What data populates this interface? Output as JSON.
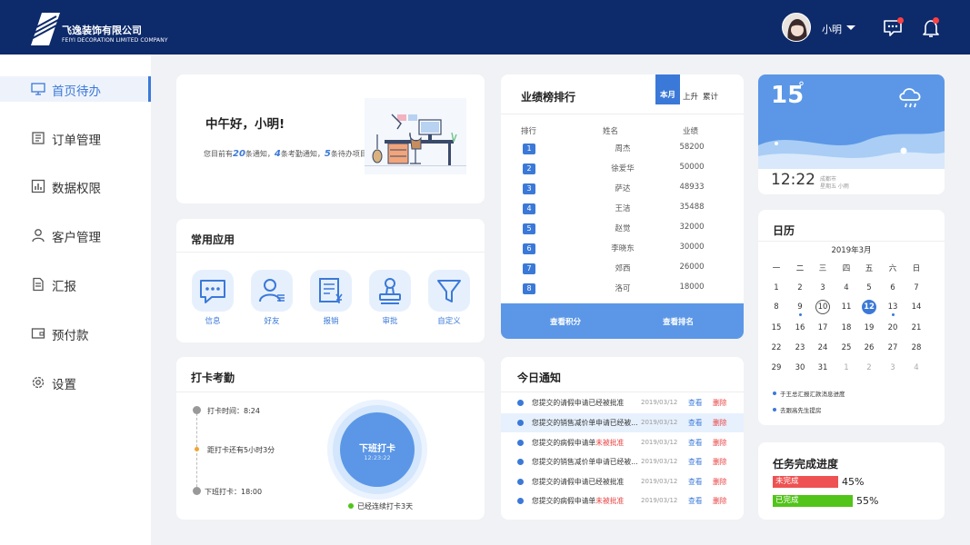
{
  "header": {
    "company_name": "飞逸装饰有限公司",
    "company_name_en": "FEIYI DECORATION LIMITED COMPANY",
    "user_name": "小明",
    "brand_color": "#0d2a6b"
  },
  "sidebar": {
    "items": [
      {
        "label": "首页待办",
        "icon": "monitor-icon",
        "active": true
      },
      {
        "label": "订单管理",
        "icon": "order-icon"
      },
      {
        "label": "数据权限",
        "icon": "chart-icon"
      },
      {
        "label": "客户管理",
        "icon": "user-icon"
      },
      {
        "label": "汇报",
        "icon": "report-icon"
      },
      {
        "label": "预付款",
        "icon": "wallet-icon"
      },
      {
        "label": "设置",
        "icon": "gear-icon"
      }
    ]
  },
  "welcome": {
    "greeting": "中午好，小明!",
    "sub_pre": "您目前有",
    "n1": "20",
    "sub_1": "条通知，",
    "n2": "4",
    "sub_2": "条考勤通知，",
    "n3": "5",
    "sub_3": "条待办项目"
  },
  "apps": {
    "title": "常用应用",
    "items": [
      {
        "label": "信息",
        "icon": "chat-icon"
      },
      {
        "label": "好友",
        "icon": "friend-icon"
      },
      {
        "label": "报销",
        "icon": "reimburse-icon"
      },
      {
        "label": "审批",
        "icon": "stamp-icon"
      },
      {
        "label": "自定义",
        "icon": "filter-icon"
      }
    ]
  },
  "attendance": {
    "title": "打卡考勤",
    "clock_in": "打卡时间：8:24",
    "remaining": "距打卡还有5小时3分",
    "clock_out": "下班打卡：18:00",
    "button_label": "下班打卡",
    "button_time": "12:23:22",
    "streak": "已经连续打卡3天"
  },
  "ranking": {
    "title": "业绩榜排行",
    "tabs": [
      "本月",
      "上升",
      "累计"
    ],
    "columns": [
      "排行",
      "姓名",
      "业绩"
    ],
    "rows": [
      {
        "rank": "1",
        "name": "周杰",
        "value": "58200"
      },
      {
        "rank": "2",
        "name": "徐爱华",
        "value": "50000"
      },
      {
        "rank": "3",
        "name": "萨达",
        "value": "48933"
      },
      {
        "rank": "4",
        "name": "王洁",
        "value": "35488"
      },
      {
        "rank": "5",
        "name": "赵觉",
        "value": "32000"
      },
      {
        "rank": "6",
        "name": "李晓东",
        "value": "30000"
      },
      {
        "rank": "7",
        "name": "郊西",
        "value": "26000"
      },
      {
        "rank": "8",
        "name": "洛可",
        "value": "18000"
      }
    ],
    "footer_left": "查看积分",
    "footer_right": "查看排名"
  },
  "notices": {
    "title": "今日通知",
    "view_label": "查看",
    "delete_label": "删除",
    "items": [
      {
        "text": "您提交的请假申请已经被批准",
        "red": "",
        "date": "2019/03/12"
      },
      {
        "text": "您提交的销售减价单申请已经被...",
        "red": "",
        "date": "2019/03/12"
      },
      {
        "text": "您提交的病假申请单",
        "red": "未被批准",
        "date": "2019/03/12"
      },
      {
        "text": "您提交的销售减价单申请已经被...",
        "red": "",
        "date": "2019/03/12"
      },
      {
        "text": "您提交的请假申请已经被批准",
        "red": "",
        "date": "2019/03/12"
      },
      {
        "text": "您提交的病假申请单",
        "red": "未被批准",
        "date": "2019/03/12"
      }
    ]
  },
  "weather": {
    "temperature": "15",
    "degree": "°",
    "time": "12:22",
    "location": "成都市",
    "detail": "星期五 小雨"
  },
  "calendar": {
    "title": "日历",
    "month": "2019年3月",
    "weekdays": [
      "一",
      "二",
      "三",
      "四",
      "五",
      "六",
      "日"
    ],
    "days": [
      [
        "1",
        "2",
        "3",
        "4",
        "5",
        "6",
        "7"
      ],
      [
        "8",
        "9",
        "10",
        "11",
        "12",
        "13",
        "14"
      ],
      [
        "15",
        "16",
        "17",
        "18",
        "19",
        "20",
        "21"
      ],
      [
        "22",
        "23",
        "24",
        "25",
        "26",
        "27",
        "28"
      ],
      [
        "29",
        "30",
        "31",
        "1",
        "2",
        "3",
        "4"
      ]
    ],
    "events": [
      "于王总汇报汇款消息进度",
      "去跟高先生提房"
    ]
  },
  "tasks": {
    "title": "任务完成进度",
    "items": [
      {
        "label": "未完成",
        "percent": "45%",
        "value": 0.45,
        "color": "#ee5252"
      },
      {
        "label": "已完成",
        "percent": "55%",
        "value": 0.55,
        "color": "#52c41a"
      }
    ]
  }
}
